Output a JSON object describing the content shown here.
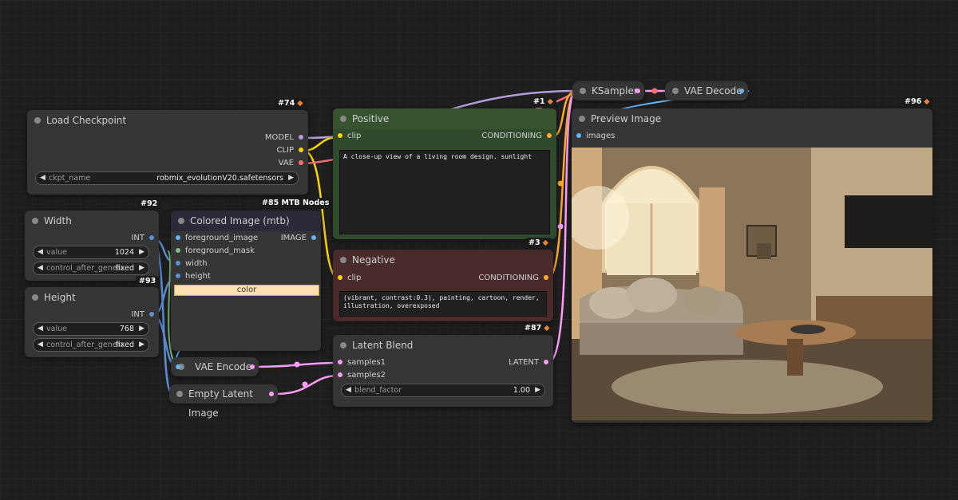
{
  "nodes": {
    "load_checkpoint": {
      "title": "Load Checkpoint",
      "badge": "#74",
      "outputs": [
        "MODEL",
        "CLIP",
        "VAE"
      ],
      "ckpt_label": "ckpt_name",
      "ckpt_value": "robmix_evolutionV20.safetensors"
    },
    "width": {
      "title": "Width",
      "badge": "#92",
      "output": "INT",
      "value_label": "value",
      "value": "1024",
      "control_label": "control_after_generate",
      "control_value": "fixed"
    },
    "height": {
      "title": "Height",
      "badge": "#93",
      "output": "INT",
      "value_label": "value",
      "value": "768",
      "control_label": "control_after_generate",
      "control_value": "fixed"
    },
    "colored_image": {
      "title": "Colored Image (mtb)",
      "badge": "#85 MTB Nodes",
      "inputs": [
        "foreground_image",
        "foreground_mask",
        "width",
        "height"
      ],
      "output": "IMAGE",
      "color_label": "color"
    },
    "positive": {
      "title": "Positive",
      "badge": "#3",
      "input": "clip",
      "output": "CONDITIONING",
      "text": "A close-up view of a living room design. sunlight"
    },
    "negative": {
      "title": "Negative",
      "badge": "#87",
      "input": "clip",
      "output": "CONDITIONING",
      "text": "(vibrant, contrast:0.3), painting, cartoon, render, illustration, overexposed"
    },
    "latent_blend": {
      "title": "Latent Blend",
      "inputs": [
        "samples1",
        "samples2"
      ],
      "output": "LATENT",
      "factor_label": "blend_factor",
      "factor_value": "1.00"
    },
    "vae_encode": {
      "title": "VAE Encode"
    },
    "empty_latent": {
      "title": "Empty Latent Image"
    },
    "ksampler": {
      "title": "KSampler",
      "badge": "#1"
    },
    "vae_decode": {
      "title": "VAE Decode"
    },
    "preview": {
      "title": "Preview Image",
      "badge": "#96",
      "input": "images"
    }
  },
  "colors": {
    "model": "#b39ddb",
    "clip": "#ffd500",
    "vae": "#ff6e6e",
    "conditioning": "#ffa931",
    "latent": "#ff9cf9",
    "image": "#64b5f6",
    "int": "#5d8ed8",
    "positive_bg": "#2f4a2c",
    "negative_bg": "#4a2a2a"
  }
}
